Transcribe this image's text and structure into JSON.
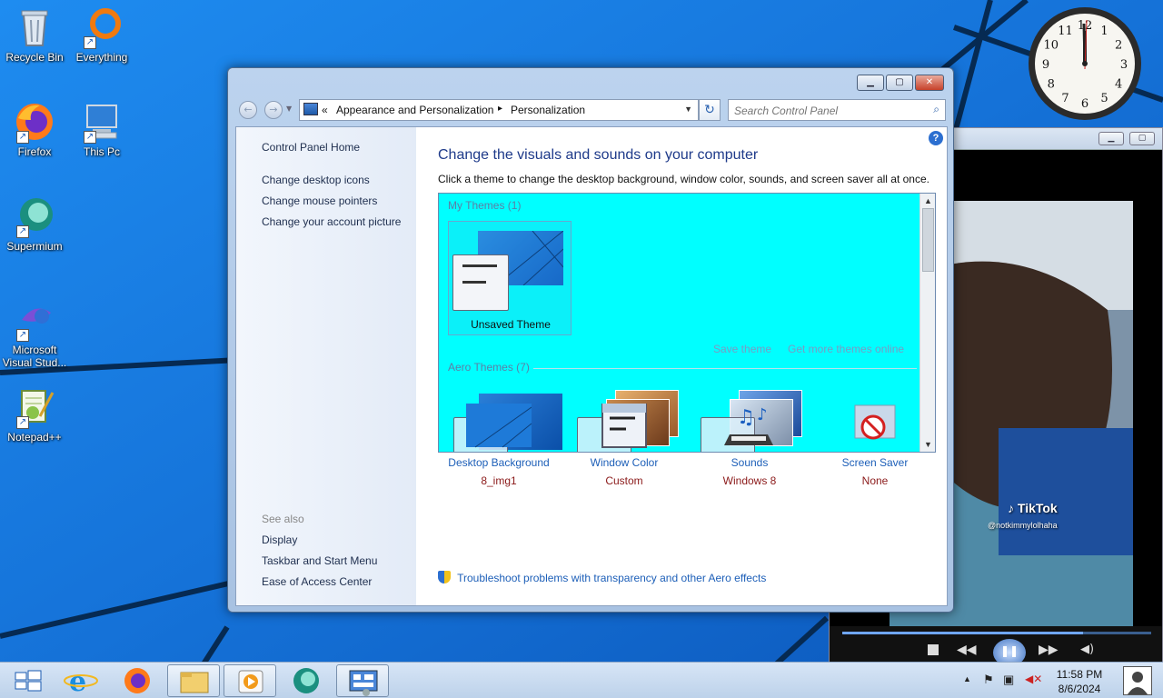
{
  "desktop": {
    "icons": [
      {
        "label": "Recycle Bin"
      },
      {
        "label": "Everything"
      },
      {
        "label": "Firefox"
      },
      {
        "label": "This Pc"
      },
      {
        "label": "Supermium"
      },
      {
        "label": "Microsoft Visual Stud..."
      },
      {
        "label": "Notepad++"
      }
    ]
  },
  "clock": {
    "hours": [
      12,
      1,
      2,
      3,
      4,
      5,
      6,
      7,
      8,
      9,
      10,
      11
    ]
  },
  "media_window": {
    "tiktok_brand": "TikTok",
    "tiktok_user": "@notkimmylolhaha",
    "progress": 0.78
  },
  "control_panel": {
    "address": {
      "root_marker": "«",
      "crumb1": "Appearance and Personalization",
      "separator": "▸",
      "crumb2": "Personalization"
    },
    "search_placeholder": "Search Control Panel",
    "left_pane": {
      "home": "Control Panel Home",
      "links": [
        "Change desktop icons",
        "Change mouse pointers",
        "Change your account picture"
      ],
      "see_also_heading": "See also",
      "see_also": [
        "Display",
        "Taskbar and Start Menu",
        "Ease of Access Center"
      ]
    },
    "main": {
      "title": "Change the visuals and sounds on your computer",
      "subtitle": "Click a theme to change the desktop background, window color, sounds, and screen saver all at once.",
      "my_themes_label": "My Themes (1)",
      "unsaved_theme_label": "Unsaved Theme",
      "save_theme_link": "Save theme",
      "get_more_link": "Get more themes online",
      "aero_themes_label": "Aero Themes (7)",
      "bottom_items": [
        {
          "label": "Desktop Background",
          "value": "8_img1"
        },
        {
          "label": "Window Color",
          "value": "Custom"
        },
        {
          "label": "Sounds",
          "value": "Windows 8"
        },
        {
          "label": "Screen Saver",
          "value": "None"
        }
      ],
      "troubleshoot_link": "Troubleshoot problems with transparency and other Aero effects"
    },
    "colors": {
      "theme_area_bg": "#00ffff",
      "link": "#1d5fb8",
      "value": "#8b1a1a"
    }
  },
  "taskbar": {
    "time": "11:58 PM",
    "date": "8/6/2024",
    "pinned": [
      "start",
      "internet-explorer",
      "firefox",
      "file-explorer",
      "media-player",
      "supermium",
      "control-panel"
    ]
  }
}
